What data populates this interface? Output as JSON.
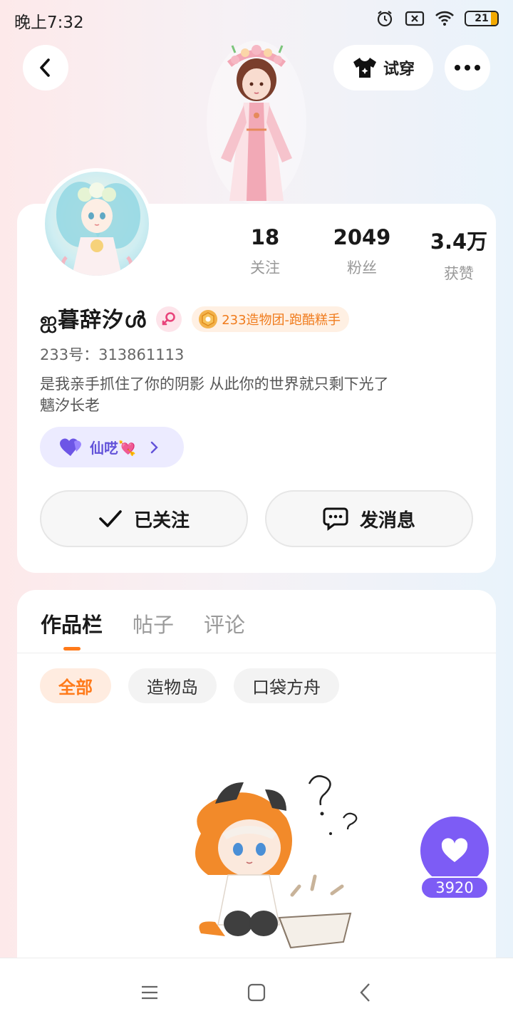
{
  "status_bar": {
    "time": "晚上7:32",
    "battery_level": "21",
    "icons": [
      "alarm-icon",
      "sim-off-icon",
      "wifi-icon",
      "battery-icon"
    ]
  },
  "header": {
    "back_icon": "chevron-left-icon",
    "tryon_label": "试穿",
    "tryon_icon": "tshirt-sparkle-icon",
    "more_icon": "more-dots-icon"
  },
  "profile": {
    "stats": [
      {
        "value": "18",
        "label": "关注"
      },
      {
        "value": "2049",
        "label": "粉丝"
      },
      {
        "value": "3.4万",
        "label": "获赞"
      }
    ],
    "username": "ஐ暮辞汐ൾ",
    "gender_icon": "female-icon",
    "team_badge": "233造物团-跑酷糕手",
    "uid": "233号：313861113",
    "bio_line1": "是我亲手抓住了你的阴影 从此你的世界就只剩下光了",
    "bio_line2": "魑汐长老",
    "group": {
      "name": "仙呓💘",
      "icon": "purple-heart-icon"
    },
    "follow_label": "已关注",
    "message_label": "发消息"
  },
  "works": {
    "tabs": [
      {
        "label": "作品栏",
        "active": true
      },
      {
        "label": "帖子",
        "active": false
      },
      {
        "label": "评论",
        "active": false
      }
    ],
    "filters": [
      {
        "label": "全部",
        "active": true
      },
      {
        "label": "造物岛",
        "active": false
      },
      {
        "label": "口袋方舟",
        "active": false
      }
    ]
  },
  "like_fab": {
    "count": "3920",
    "icon": "heart-icon"
  },
  "nav": [
    "menu-icon",
    "home-square-icon",
    "back-triangle-icon"
  ],
  "colors": {
    "accent": "#ff7a1a",
    "purple": "#7d5cf5",
    "pink": "#e8437a"
  }
}
